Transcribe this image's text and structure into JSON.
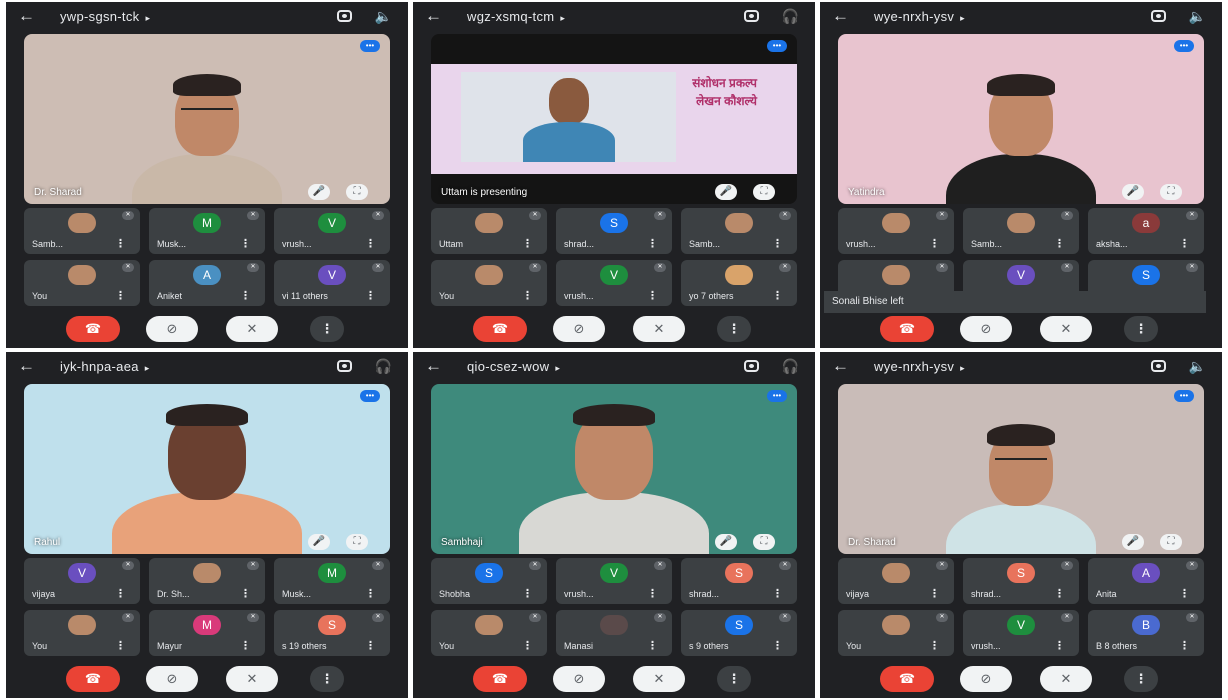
{
  "panels": [
    {
      "meeting_code": "ywp-sgsn-tck",
      "audio_icon": "speaker-icon",
      "audio_glyph": "🔈",
      "main_label": "Dr. Sharad",
      "bg": "#cdbdb4",
      "shirt": "#c9b8a8",
      "speaker_glyph": "🎤",
      "tiles": [
        {
          "name": "Samb...",
          "avatar": "",
          "avatar_color": "#b98a6a"
        },
        {
          "name": "Musk...",
          "avatar": "M",
          "avatar_color": "#1e8e3e"
        },
        {
          "name": "vrush...",
          "avatar": "V",
          "avatar_color": "#1e8e3e"
        },
        {
          "name": "You",
          "avatar": "",
          "avatar_color": "#b98a6a"
        },
        {
          "name": "Aniket",
          "avatar": "A",
          "avatar_color": "#4a90c2"
        },
        {
          "name": "vi 11 others",
          "avatar": "V",
          "avatar_color": "#6a4fbf"
        }
      ],
      "toast": ""
    },
    {
      "meeting_code": "wgz-xsmq-tcm",
      "audio_icon": "headphones-icon",
      "audio_glyph": "🎧",
      "main_label": "Uttam is presenting",
      "bg": "#141414",
      "shirt": "#3f86b5",
      "speaker_glyph": "🎤",
      "slide_text_1": "संशोधन प्रकल्प",
      "slide_text_2": "लेखन कौशल्ये",
      "tiles": [
        {
          "name": "Uttam",
          "avatar": "",
          "avatar_color": "#b98a6a"
        },
        {
          "name": "shrad...",
          "avatar": "S",
          "avatar_color": "#1a73e8"
        },
        {
          "name": "Samb...",
          "avatar": "",
          "avatar_color": "#b98a6a"
        },
        {
          "name": "You",
          "avatar": "",
          "avatar_color": "#b98a6a"
        },
        {
          "name": "vrush...",
          "avatar": "V",
          "avatar_color": "#1e8e3e"
        },
        {
          "name": "yo 7 others",
          "avatar": "",
          "avatar_color": "#d9a36a"
        }
      ],
      "toast": ""
    },
    {
      "meeting_code": "wye-nrxh-ysv",
      "audio_icon": "speaker-icon",
      "audio_glyph": "🔈",
      "main_label": "Yatindra",
      "bg": "#e8c4cf",
      "shirt": "#1f1f1f",
      "speaker_glyph": "🎤",
      "tiles": [
        {
          "name": "vrush...",
          "avatar": "",
          "avatar_color": "#b98a6a"
        },
        {
          "name": "Samb...",
          "avatar": "",
          "avatar_color": "#b98a6a"
        },
        {
          "name": "aksha...",
          "avatar": "a",
          "avatar_color": "#8a3a3a"
        },
        {
          "name": "",
          "avatar": "",
          "avatar_color": "#b98a6a"
        },
        {
          "name": "",
          "avatar": "V",
          "avatar_color": "#6a4fbf"
        },
        {
          "name": "",
          "avatar": "S",
          "avatar_color": "#1a73e8"
        }
      ],
      "toast": "Sonali Bhise left"
    },
    {
      "meeting_code": "iyk-hnpa-aea",
      "audio_icon": "headphones-icon",
      "audio_glyph": "🎧",
      "main_label": "Rahul",
      "bg": "#bfe0ec",
      "shirt": "#e8a27a",
      "speaker_glyph": "🎤",
      "tiles": [
        {
          "name": "vijaya",
          "avatar": "V",
          "avatar_color": "#6a4fbf"
        },
        {
          "name": "Dr. Sh...",
          "avatar": "",
          "avatar_color": "#b98a6a"
        },
        {
          "name": "Musk...",
          "avatar": "M",
          "avatar_color": "#1e8e3e"
        },
        {
          "name": "You",
          "avatar": "",
          "avatar_color": "#b98a6a"
        },
        {
          "name": "Mayur",
          "avatar": "M",
          "avatar_color": "#d93a7a"
        },
        {
          "name": "s 19 others",
          "avatar": "S",
          "avatar_color": "#e8735c"
        }
      ],
      "toast": ""
    },
    {
      "meeting_code": "qio-csez-wow",
      "audio_icon": "headphones-icon",
      "audio_glyph": "🎧",
      "main_label": "Sambhaji",
      "bg": "#3e8a7c",
      "shirt": "#d8d8d4",
      "speaker_glyph": "🎤",
      "tiles": [
        {
          "name": "Shobha",
          "avatar": "S",
          "avatar_color": "#1a73e8"
        },
        {
          "name": "vrush...",
          "avatar": "V",
          "avatar_color": "#1e8e3e"
        },
        {
          "name": "shrad...",
          "avatar": "S",
          "avatar_color": "#e8735c"
        },
        {
          "name": "You",
          "avatar": "",
          "avatar_color": "#b98a6a"
        },
        {
          "name": "Manasi",
          "avatar": "",
          "avatar_color": "#5a4a4a"
        },
        {
          "name": "s 9 others",
          "avatar": "S",
          "avatar_color": "#1a73e8"
        }
      ],
      "toast": ""
    },
    {
      "meeting_code": "wye-nrxh-ysv",
      "audio_icon": "speaker-icon",
      "audio_glyph": "🔈",
      "main_label": "Dr. Sharad",
      "bg": "#c9bcb8",
      "shirt": "#cfe3e6",
      "speaker_glyph": "🎤",
      "tiles": [
        {
          "name": "vijaya",
          "avatar": "",
          "avatar_color": "#b98a6a"
        },
        {
          "name": "shrad...",
          "avatar": "S",
          "avatar_color": "#e8735c"
        },
        {
          "name": "Anita",
          "avatar": "A",
          "avatar_color": "#6a4fbf"
        },
        {
          "name": "You",
          "avatar": "",
          "avatar_color": "#b98a6a"
        },
        {
          "name": "vrush...",
          "avatar": "V",
          "avatar_color": "#1e8e3e"
        },
        {
          "name": "B 8 others",
          "avatar": "B",
          "avatar_color": "#4a6ad0"
        }
      ],
      "toast": ""
    }
  ],
  "common": {
    "back_glyph": "←",
    "caret_glyph": "▸",
    "more_glyph": "⋮",
    "dots_glyph": "•••",
    "end_call_glyph": "☎",
    "video_off_glyph": "⊘",
    "mic_off_glyph": "✕",
    "fullscreen_glyph": "⛶",
    "kebab_glyph": "⋮",
    "mute_glyph": "✕"
  }
}
